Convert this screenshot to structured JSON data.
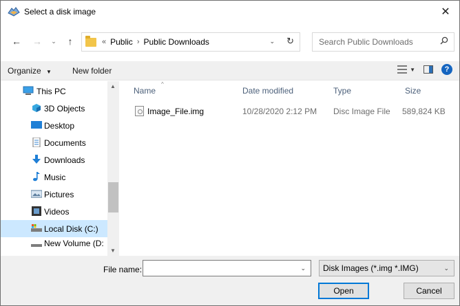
{
  "window": {
    "title": "Select a disk image",
    "close_glyph": "✕"
  },
  "nav": {
    "back_glyph": "←",
    "forward_glyph": "→",
    "recent_glyph": "⌄",
    "up_glyph": "↑",
    "breadcrumb_overflow": "«",
    "breadcrumb": [
      "Public",
      "Public Downloads"
    ],
    "breadcrumb_sep": "›",
    "dropdown_glyph": "⌄",
    "refresh_glyph": "↻",
    "search_placeholder": "Search Public Downloads"
  },
  "toolbar": {
    "organize": "Organize",
    "organize_caret": "▼",
    "new_folder": "New folder",
    "view_caret": "▼",
    "help": "?"
  },
  "navpane": {
    "items": [
      {
        "label": "This PC",
        "icon": "computer-icon",
        "level": "top"
      },
      {
        "label": "3D Objects",
        "icon": "3d-objects-icon",
        "level": "child"
      },
      {
        "label": "Desktop",
        "icon": "desktop-icon",
        "level": "child"
      },
      {
        "label": "Documents",
        "icon": "documents-icon",
        "level": "child"
      },
      {
        "label": "Downloads",
        "icon": "downloads-icon",
        "level": "child"
      },
      {
        "label": "Music",
        "icon": "music-icon",
        "level": "child"
      },
      {
        "label": "Pictures",
        "icon": "pictures-icon",
        "level": "child"
      },
      {
        "label": "Videos",
        "icon": "videos-icon",
        "level": "child"
      },
      {
        "label": "Local Disk (C:)",
        "icon": "local-disk-icon",
        "level": "child",
        "selected": true
      },
      {
        "label": "New Volume (D:",
        "icon": "drive-icon",
        "level": "child",
        "partial": true
      }
    ],
    "scroll_up": "▲",
    "scroll_down": "▼"
  },
  "filelist": {
    "columns": {
      "name": "Name",
      "date": "Date modified",
      "type": "Type",
      "size": "Size"
    },
    "sort_glyph": "^",
    "rows": [
      {
        "name": "Image_File.img",
        "date": "10/28/2020 2:12 PM",
        "type": "Disc Image File",
        "size": "589,824 KB"
      }
    ]
  },
  "bottom": {
    "file_name_label": "File name:",
    "file_name_value": "",
    "file_name_dropdown": "⌄",
    "filter_value": "Disk Images (*.img *.IMG)",
    "filter_dropdown": "⌄",
    "open_label": "Open",
    "cancel_label": "Cancel"
  },
  "colors": {
    "selection": "#cce8ff",
    "accent": "#0078d7",
    "column_header": "#4c607a"
  }
}
